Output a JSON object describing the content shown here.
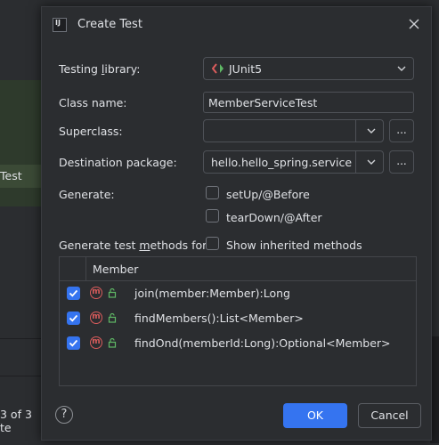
{
  "background": {
    "tree_selected_label": "Test",
    "footer_count_text": "3 of 3 te"
  },
  "dialog": {
    "title": "Create Test",
    "testing_library": {
      "label_pre": "Testing ",
      "label_u": "l",
      "label_post": "ibrary:",
      "value": "JUnit5"
    },
    "class_name": {
      "label": "Class name:",
      "value": "MemberServiceTest"
    },
    "superclass": {
      "label": "Superclass:",
      "value": "",
      "browse_label": "..."
    },
    "destination_package": {
      "label": "Destination package:",
      "value": "hello.hello_spring.service",
      "browse_label": "..."
    },
    "generate": {
      "label": "Generate:",
      "options": [
        {
          "label": "setUp/@Before",
          "checked": false
        },
        {
          "label": "tearDown/@After",
          "checked": false
        }
      ]
    },
    "generate_methods": {
      "label_pre": "Generate test ",
      "label_u": "m",
      "label_post": "ethods for:",
      "show_inherited_label": "Show inherited methods",
      "show_inherited_checked": false
    },
    "methods_table": {
      "column_header": "Member",
      "rows": [
        {
          "name": "join(member:Member):Long",
          "checked": true
        },
        {
          "name": "findMembers():List<Member>",
          "checked": true
        },
        {
          "name": "findOnd(memberId:Long):Optional<Member>",
          "checked": true
        }
      ]
    },
    "buttons": {
      "help": "?",
      "ok": "OK",
      "cancel": "Cancel"
    }
  },
  "colors": {
    "accent": "#3574f0",
    "method_icon": "#db5c5c",
    "access_icon": "#5fb865",
    "junit_icon": "#db5c5c"
  }
}
